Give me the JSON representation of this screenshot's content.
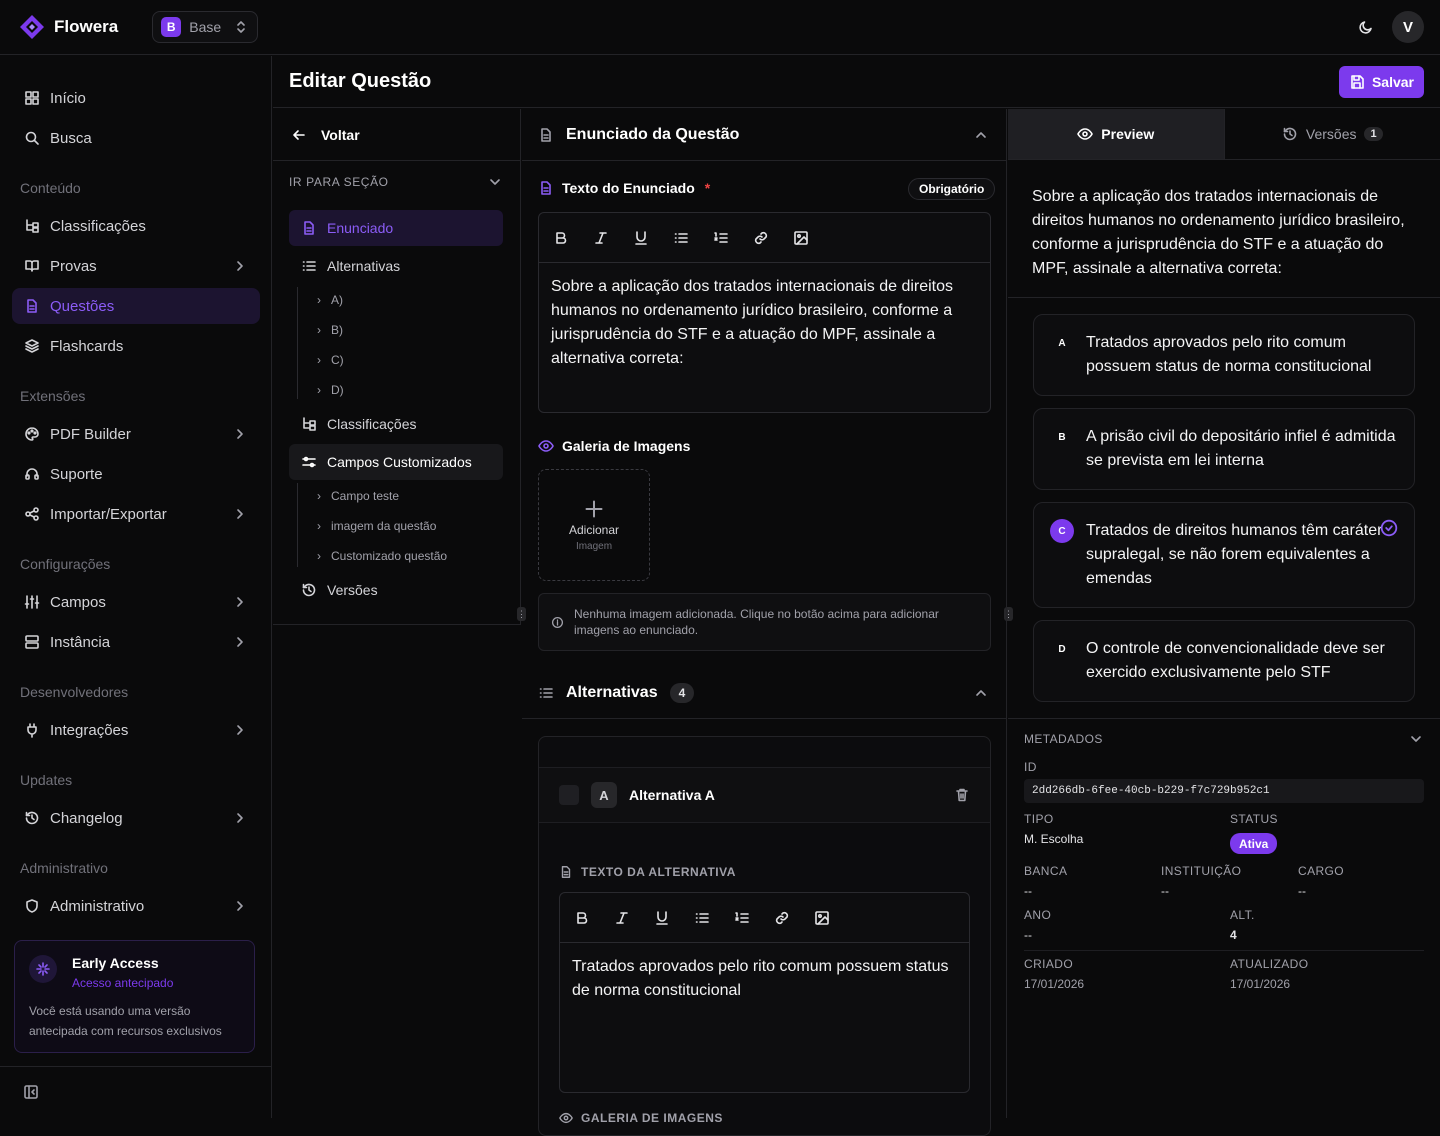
{
  "app": {
    "name": "Flowera",
    "workspace_initial": "B",
    "workspace_name": "Base",
    "user_initial": "V"
  },
  "sidebar": {
    "items": [
      {
        "label": "Início"
      },
      {
        "label": "Busca"
      }
    ],
    "sections": {
      "conteudo": "Conteúdo",
      "extensoes": "Extensões",
      "configuracoes": "Configurações",
      "desenvolvedores": "Desenvolvedores",
      "updates": "Updates",
      "administrativo": "Administrativo"
    },
    "conteudo": [
      "Classificações",
      "Provas",
      "Questões",
      "Flashcards"
    ],
    "extensoes": [
      "PDF Builder",
      "Suporte",
      "Importar/Exportar"
    ],
    "configuracoes": [
      "Campos",
      "Instância"
    ],
    "desenvolvedores": [
      "Integrações"
    ],
    "updates": [
      "Changelog"
    ],
    "administrativo": [
      "Administrativo"
    ],
    "early_access": {
      "title": "Early Access",
      "subtitle": "Acesso antecipado",
      "text": "Você está usando uma versão antecipada com recursos exclusivos"
    }
  },
  "header": {
    "title": "Editar Questão",
    "save_label": "Salvar"
  },
  "section_nav": {
    "back_label": "Voltar",
    "heading": "IR PARA SEÇÃO",
    "enunciado": "Enunciado",
    "alternativas": "Alternativas",
    "alt_items": [
      "A)",
      "B)",
      "C)",
      "D)"
    ],
    "classificacoes": "Classificações",
    "campos": "Campos Customizados",
    "campos_items": [
      "Campo teste",
      "imagem da questão",
      "Customizado questão"
    ],
    "versoes": "Versões"
  },
  "enunciado": {
    "section_title": "Enunciado da Questão",
    "field_label": "Texto do Enunciado",
    "required_mark": "*",
    "required_badge": "Obrigatório",
    "text": "Sobre a aplicação dos tratados internacionais de direitos humanos no ordenamento jurídico brasileiro, conforme a jurisprudência do STF e a atuação do MPF, assinale a alternativa correta:",
    "gallery_label": "Galeria de Imagens",
    "add_image": "Adicionar",
    "add_image_sub": "Imagem",
    "empty_note": "Nenhuma imagem adicionada. Clique no botão acima para adicionar imagens ao enunciado."
  },
  "alternativas": {
    "section_title": "Alternativas",
    "count": "4",
    "card_letter": "A",
    "card_title": "Alternativa A",
    "text_label": "TEXTO DA ALTERNATIVA",
    "text": "Tratados aprovados pelo rito comum possuem status de norma constitucional",
    "gallery_label": "GALERIA DE IMAGENS"
  },
  "preview": {
    "tab_preview": "Preview",
    "tab_versoes": "Versões",
    "versoes_count": "1",
    "stem": "Sobre a aplicação dos tratados internacionais de direitos humanos no ordenamento jurídico brasileiro, conforme a jurisprudência do STF e a atuação do MPF, assinale a alternativa correta:",
    "options": [
      {
        "letter": "A",
        "text": "Tratados aprovados pelo rito comum possuem status de norma constitucional",
        "correct": false
      },
      {
        "letter": "B",
        "text": "A prisão civil do depositário infiel é admitida se prevista em lei interna",
        "correct": false
      },
      {
        "letter": "C",
        "text": "Tratados de direitos humanos têm caráter supralegal, se não forem equivalentes a emendas",
        "correct": true
      },
      {
        "letter": "D",
        "text": "O controle de convencionalidade deve ser exercido exclusivamente pelo STF",
        "correct": false
      }
    ]
  },
  "metadata": {
    "heading": "METADADOS",
    "id_label": "ID",
    "id": "2dd266db-6fee-40cb-b229-f7c729b952c1",
    "tipo_label": "TIPO",
    "tipo": "M. Escolha",
    "status_label": "STATUS",
    "status": "Ativa",
    "banca_label": "BANCA",
    "banca": "--",
    "instituicao_label": "INSTITUIÇÃO",
    "instituicao": "--",
    "cargo_label": "CARGO",
    "cargo": "--",
    "ano_label": "ANO",
    "ano": "--",
    "alt_label": "ALT.",
    "alt": "4",
    "criado_label": "CRIADO",
    "criado": "17/01/2026",
    "atualizado_label": "ATUALIZADO",
    "atualizado": "17/01/2026"
  },
  "colors": {
    "accent": "#7c3aed",
    "accent_text": "#8b5cf6",
    "background": "#0a0a0b",
    "required": "#ef4444"
  }
}
